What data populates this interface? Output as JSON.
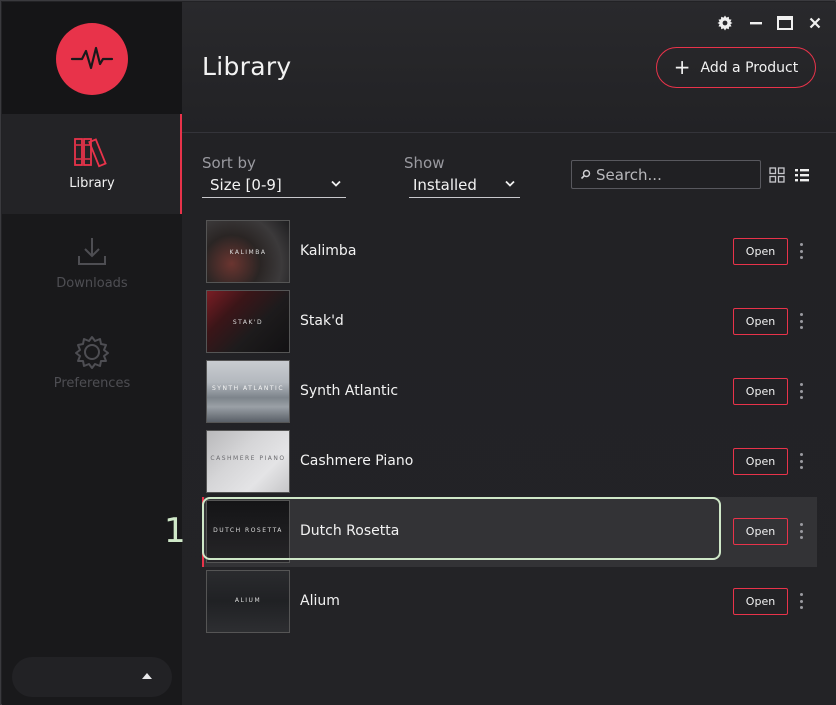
{
  "window_controls": {
    "settings": "gear-icon",
    "minimize": "minimize-icon",
    "maximize": "maximize-icon",
    "close": "close-icon"
  },
  "sidebar": {
    "items": [
      {
        "label": "Library",
        "icon": "books-icon",
        "active": true
      },
      {
        "label": "Downloads",
        "icon": "download-icon",
        "active": false
      },
      {
        "label": "Preferences",
        "icon": "gear-icon",
        "active": false
      }
    ]
  },
  "header": {
    "title": "Library",
    "add_button": "Add a Product"
  },
  "filters": {
    "sort_label": "Sort by",
    "sort_value": "Size [0-9]",
    "show_label": "Show",
    "show_value": "Installed",
    "search_placeholder": "Search..."
  },
  "products": [
    {
      "name": "Kalimba",
      "thumb_label": "KALIMBA",
      "action": "Open"
    },
    {
      "name": "Stak'd",
      "thumb_label": "STAK'D",
      "action": "Open"
    },
    {
      "name": "Synth Atlantic",
      "thumb_label": "SYNTH ATLANTIC",
      "action": "Open"
    },
    {
      "name": "Cashmere Piano",
      "thumb_label": "CASHMERE PIANO",
      "action": "Open"
    },
    {
      "name": "Dutch Rosetta",
      "thumb_label": "DUTCH ROSETTA",
      "action": "Open"
    },
    {
      "name": "Alium",
      "thumb_label": "ALIUM",
      "action": "Open"
    }
  ],
  "annotation": {
    "marker": "1"
  },
  "colors": {
    "accent": "#e8334a",
    "highlight": "#cfe8c8"
  }
}
